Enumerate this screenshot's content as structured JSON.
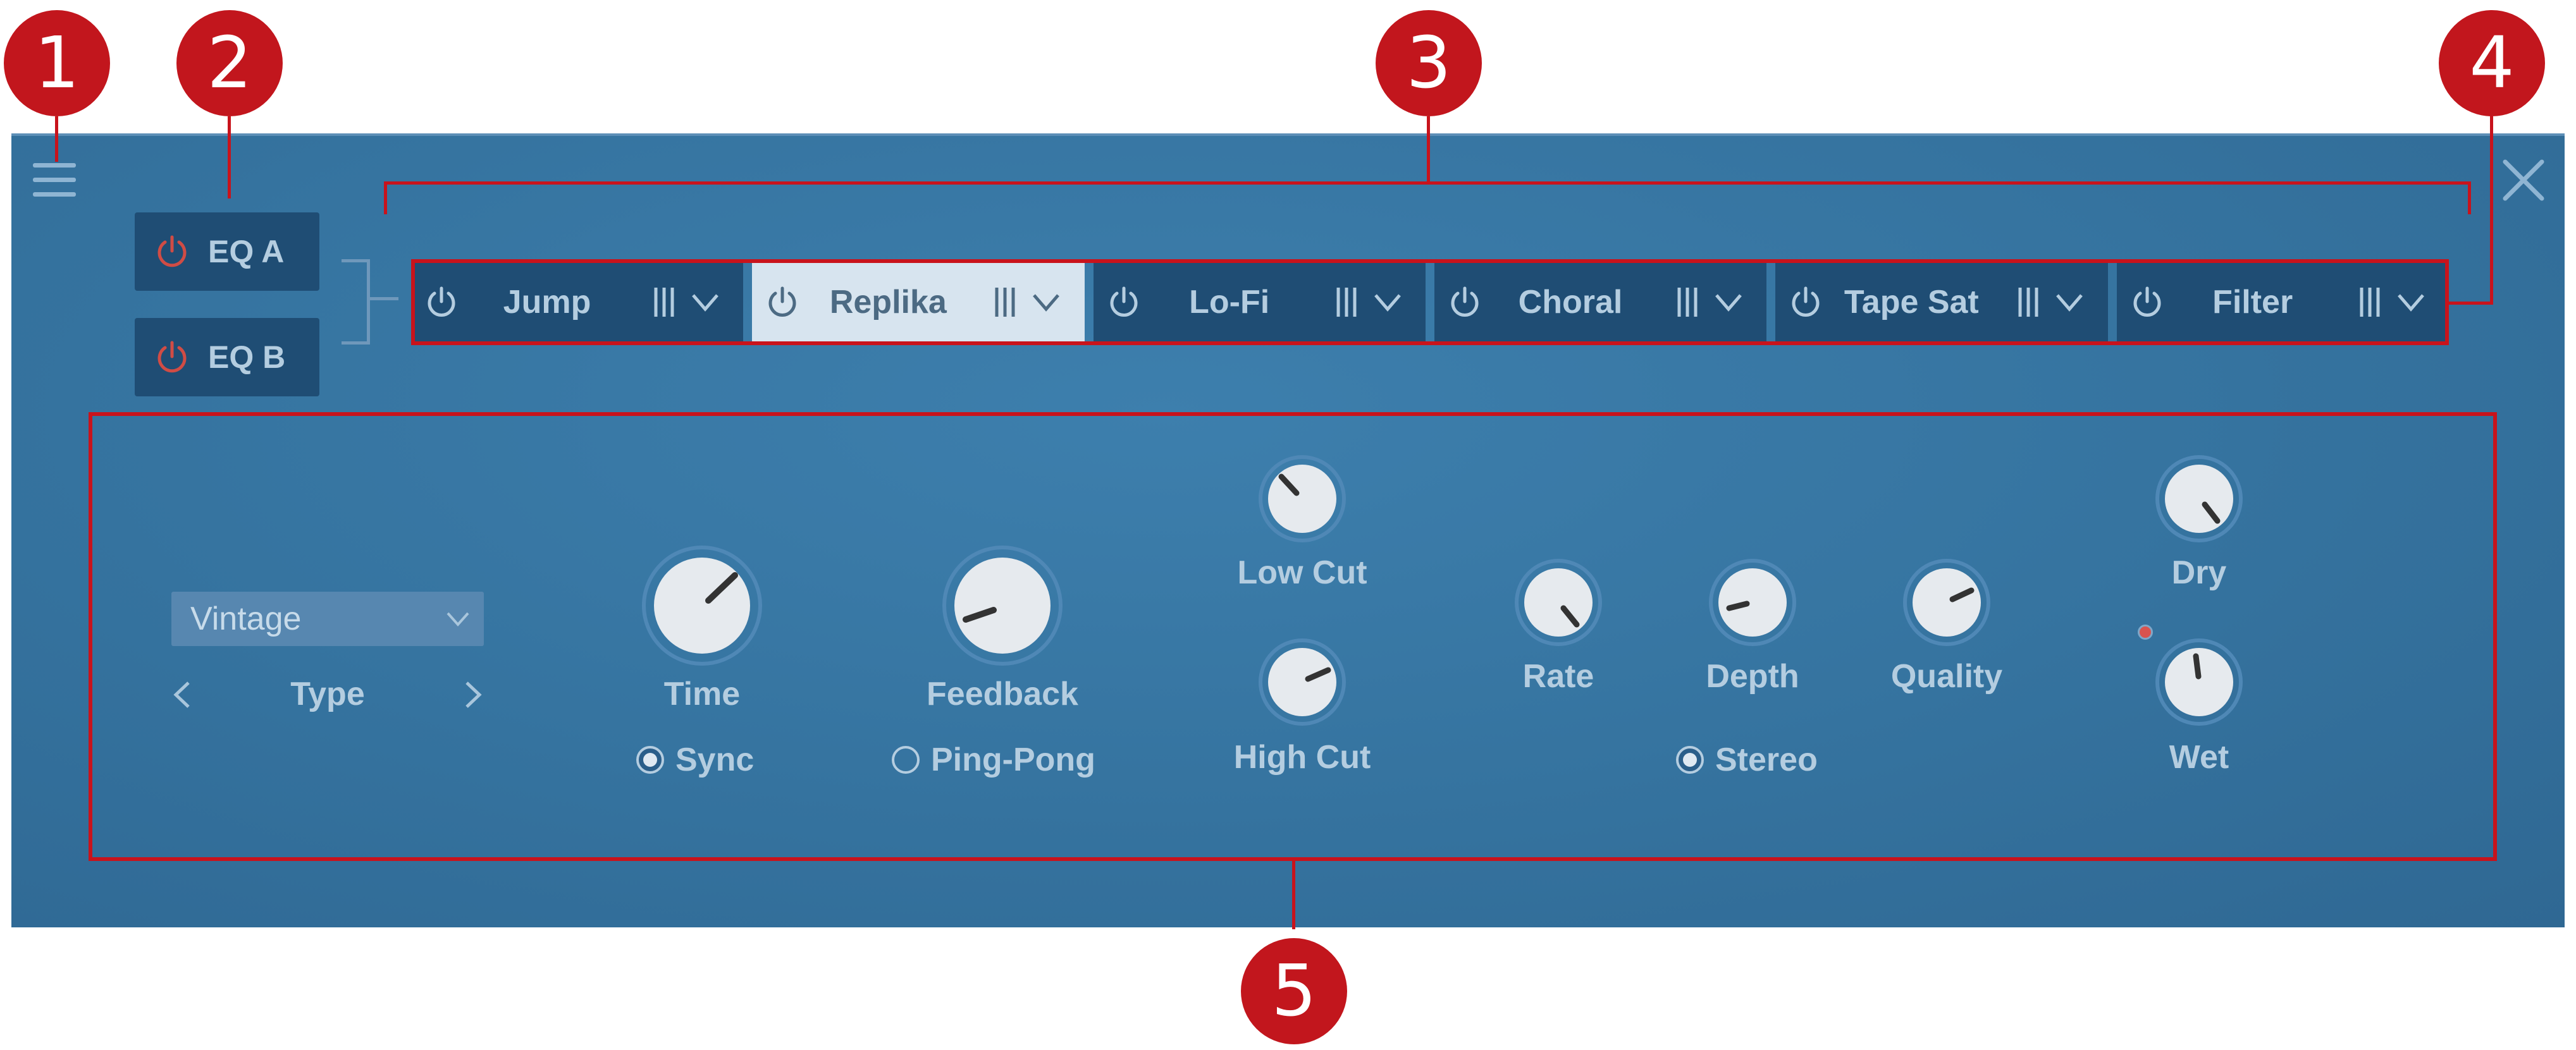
{
  "window": {
    "menu_icon": "hamburger-menu-icon",
    "close_icon": "close-x-icon"
  },
  "eq": {
    "a_label": "EQ A",
    "b_label": "EQ B",
    "power_icon": "power-icon",
    "power_color": "#d04c45"
  },
  "chain": {
    "slots": [
      {
        "name": "Jump",
        "active": false
      },
      {
        "name": "Replika",
        "active": true
      },
      {
        "name": "Lo-Fi",
        "active": false
      },
      {
        "name": "Choral",
        "active": false
      },
      {
        "name": "Tape Sat",
        "active": false
      },
      {
        "name": "Filter",
        "active": false
      }
    ],
    "drag_icon": "drag-handle-icon",
    "menu_icon": "chevron-down-icon"
  },
  "device": {
    "type_value": "Vintage",
    "type_label": "Type",
    "knobs": {
      "time": "Time",
      "feedback": "Feedback",
      "low_cut": "Low Cut",
      "high_cut": "High Cut",
      "rate": "Rate",
      "depth": "Depth",
      "quality": "Quality",
      "dry": "Dry",
      "wet": "Wet"
    },
    "sync_label": "Sync",
    "sync_on": true,
    "pingpong_label": "Ping-Pong",
    "pingpong_on": false,
    "stereo_label": "Stereo",
    "stereo_on": true
  },
  "annotations": [
    "1",
    "2",
    "3",
    "4",
    "5"
  ],
  "colors": {
    "panel": "#35739f",
    "slot": "#1f4d74",
    "slot_active": "#d7e4ef",
    "annotation": "#c2161d"
  }
}
